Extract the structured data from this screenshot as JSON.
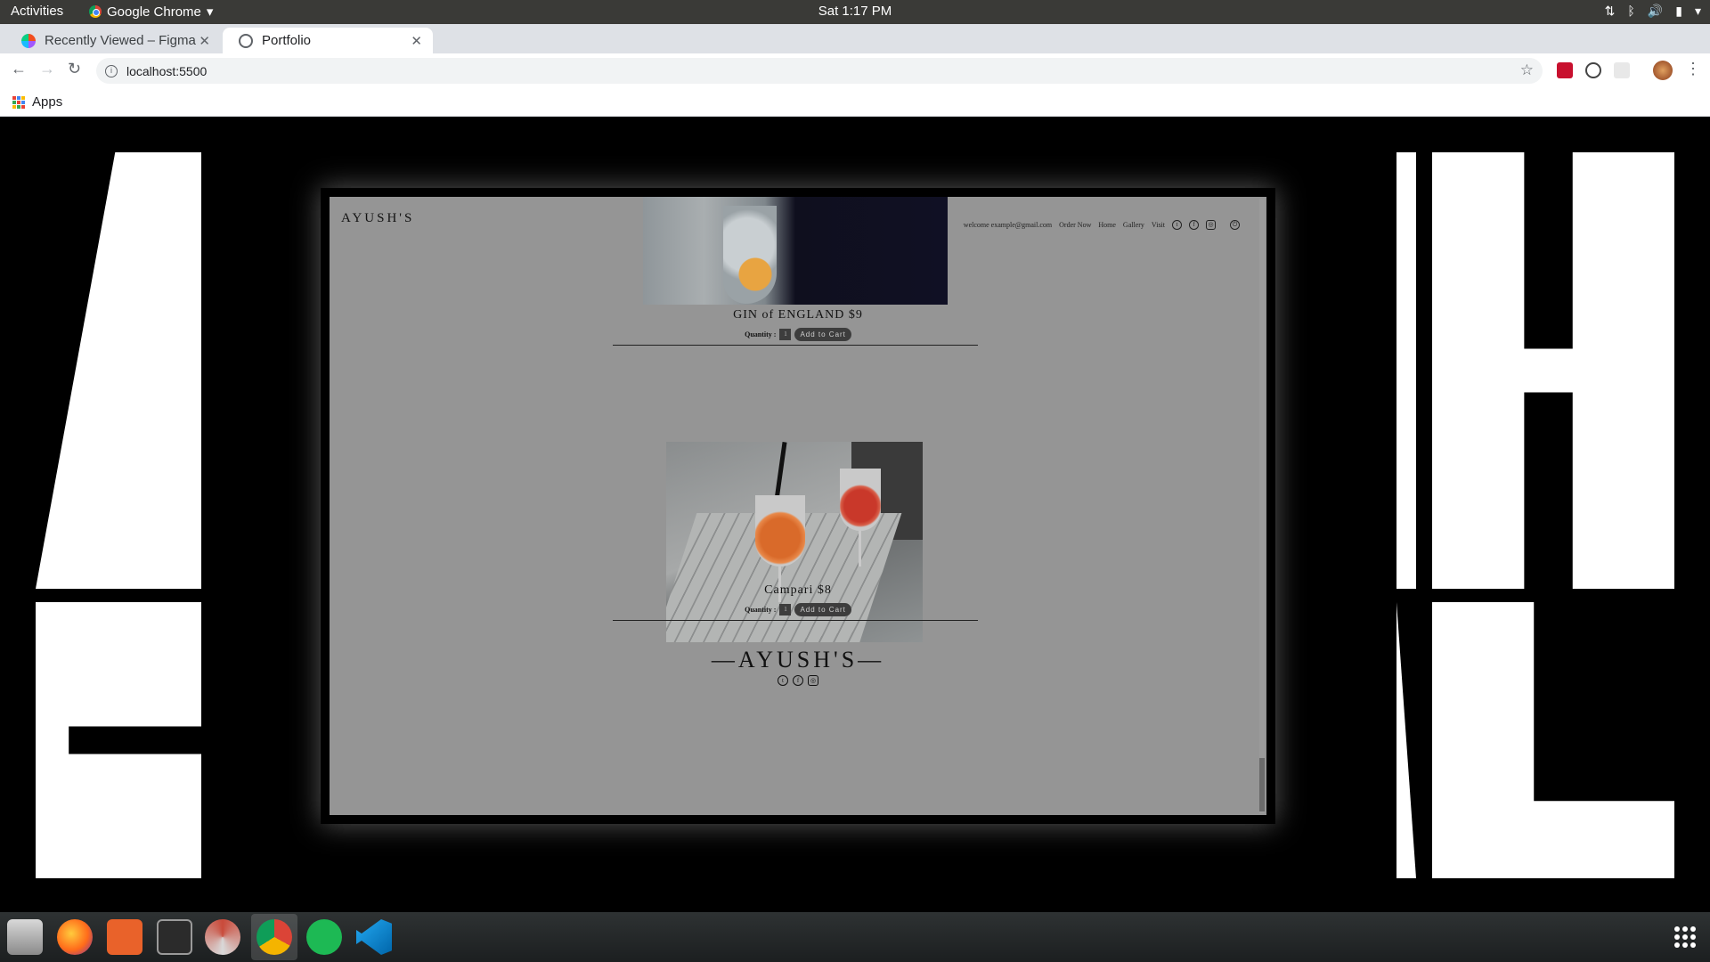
{
  "topbar": {
    "activities": "Activities",
    "app_name": "Google Chrome",
    "clock": "Sat  1:17 PM"
  },
  "tabs": [
    {
      "label": "Recently Viewed – Figma",
      "close": "✕"
    },
    {
      "label": "Portfolio",
      "close": "✕"
    }
  ],
  "new_tab": "+",
  "address": {
    "url": "localhost:5500",
    "info": "i"
  },
  "bookmarks": {
    "apps_label": "Apps"
  },
  "site": {
    "logo": "AYUSH'S",
    "nav": [
      "welcome example@gmail.com",
      "Order Now",
      "Home",
      "Gallery",
      "Visit"
    ],
    "products": [
      {
        "title": "GIN of ENGLAND $9",
        "qty_label": "Quantity :",
        "qty": "1",
        "button": "Add to Cart"
      },
      {
        "title": "Campari $8",
        "qty_label": "Quantity :",
        "qty": "1",
        "button": "Add to Cart"
      }
    ],
    "footer_logo": "—AYUSH'S—"
  },
  "colors": {
    "site_bg": "#959595",
    "frame_bg": "#000000",
    "button_bg": "#3d3d3d",
    "chrome_tabbar": "#dee1e6"
  }
}
